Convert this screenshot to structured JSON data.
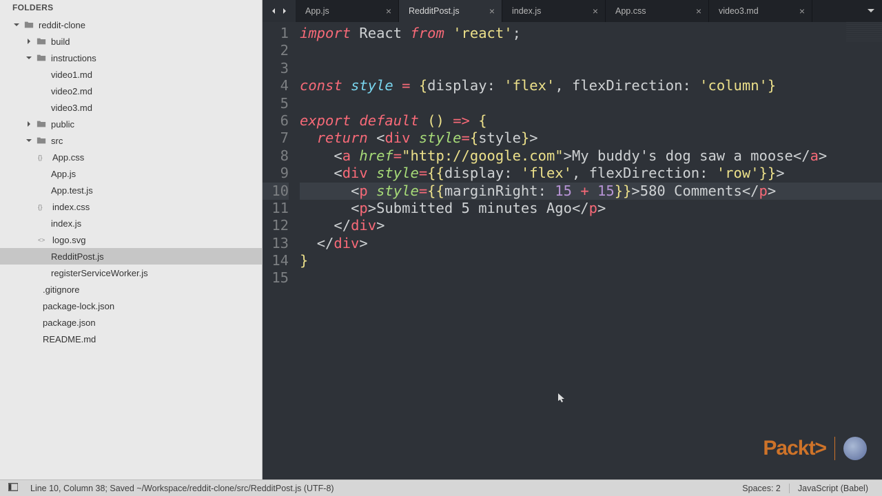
{
  "sidebar": {
    "header": "FOLDERS",
    "tree": {
      "root": "reddit-clone",
      "items": {
        "build": "build",
        "instructions": "instructions",
        "video1": "video1.md",
        "video2": "video2.md",
        "video3": "video3.md",
        "public": "public",
        "src": "src",
        "appcss": "App.css",
        "appjs": "App.js",
        "apptest": "App.test.js",
        "indexcss": "index.css",
        "indexjs": "index.js",
        "logosvg": "logo.svg",
        "redditpost": "RedditPost.js",
        "registersw": "registerServiceWorker.js",
        "gitignore": ".gitignore",
        "pkglock": "package-lock.json",
        "pkg": "package.json",
        "readme": "README.md"
      }
    }
  },
  "tabs": [
    {
      "label": "App.js",
      "active": false
    },
    {
      "label": "RedditPost.js",
      "active": true
    },
    {
      "label": "index.js",
      "active": false
    },
    {
      "label": "App.css",
      "active": false
    },
    {
      "label": "video3.md",
      "active": false
    }
  ],
  "editor": {
    "lines": 15,
    "highlight_line": 10,
    "code_tokens": [
      [
        [
          "kw",
          "import"
        ],
        [
          "pun",
          " "
        ],
        [
          "var",
          "React"
        ],
        [
          "pun",
          " "
        ],
        [
          "kw",
          "from"
        ],
        [
          "pun",
          " "
        ],
        [
          "str",
          "'react'"
        ],
        [
          "pun",
          ";"
        ]
      ],
      [],
      [],
      [
        [
          "kw",
          "const"
        ],
        [
          "pun",
          " "
        ],
        [
          "def",
          "style"
        ],
        [
          "pun",
          " "
        ],
        [
          "op",
          "="
        ],
        [
          "pun",
          " "
        ],
        [
          "paren",
          "{"
        ],
        [
          "var",
          "display"
        ],
        [
          "pun",
          ": "
        ],
        [
          "str",
          "'flex'"
        ],
        [
          "pun",
          ", "
        ],
        [
          "var",
          "flexDirection"
        ],
        [
          "pun",
          ": "
        ],
        [
          "str",
          "'column'"
        ],
        [
          "paren",
          "}"
        ]
      ],
      [],
      [
        [
          "kw",
          "export"
        ],
        [
          "pun",
          " "
        ],
        [
          "kw",
          "default"
        ],
        [
          "pun",
          " "
        ],
        [
          "paren",
          "()"
        ],
        [
          "pun",
          " "
        ],
        [
          "op",
          "=>"
        ],
        [
          "pun",
          " "
        ],
        [
          "paren",
          "{"
        ]
      ],
      [
        [
          "pun",
          "  "
        ],
        [
          "kw",
          "return"
        ],
        [
          "pun",
          " "
        ],
        [
          "pun",
          "<"
        ],
        [
          "tag",
          "div"
        ],
        [
          "pun",
          " "
        ],
        [
          "attr",
          "style"
        ],
        [
          "op",
          "="
        ],
        [
          "paren",
          "{"
        ],
        [
          "var",
          "style"
        ],
        [
          "paren",
          "}"
        ],
        [
          "pun",
          ">"
        ]
      ],
      [
        [
          "pun",
          "    "
        ],
        [
          "pun",
          "<"
        ],
        [
          "tag",
          "a"
        ],
        [
          "pun",
          " "
        ],
        [
          "attr",
          "href"
        ],
        [
          "op",
          "="
        ],
        [
          "str",
          "\"http://google.com\""
        ],
        [
          "pun",
          ">"
        ],
        [
          "txt",
          "My buddy's dog saw a moose"
        ],
        [
          "pun",
          "</"
        ],
        [
          "tag",
          "a"
        ],
        [
          "pun",
          ">"
        ]
      ],
      [
        [
          "pun",
          "    "
        ],
        [
          "pun",
          "<"
        ],
        [
          "tag",
          "div"
        ],
        [
          "pun",
          " "
        ],
        [
          "attr",
          "style"
        ],
        [
          "op",
          "="
        ],
        [
          "paren",
          "{{"
        ],
        [
          "var",
          "display"
        ],
        [
          "pun",
          ": "
        ],
        [
          "str",
          "'flex'"
        ],
        [
          "pun",
          ", "
        ],
        [
          "var",
          "flexDirection"
        ],
        [
          "pun",
          ": "
        ],
        [
          "str",
          "'row'"
        ],
        [
          "paren",
          "}}"
        ],
        [
          "pun",
          ">"
        ]
      ],
      [
        [
          "pun",
          "      "
        ],
        [
          "pun",
          "<"
        ],
        [
          "tag",
          "p"
        ],
        [
          "pun",
          " "
        ],
        [
          "attr",
          "style"
        ],
        [
          "op",
          "="
        ],
        [
          "paren",
          "{{"
        ],
        [
          "var",
          "marginRight"
        ],
        [
          "pun",
          ": "
        ],
        [
          "val",
          "15"
        ],
        [
          "pun",
          " "
        ],
        [
          "op",
          "+"
        ],
        [
          "pun",
          " "
        ],
        [
          "val",
          "15"
        ],
        [
          "paren",
          "}}"
        ],
        [
          "pun",
          ">"
        ],
        [
          "txt",
          "580 Comments"
        ],
        [
          "pun",
          "</"
        ],
        [
          "tag",
          "p"
        ],
        [
          "pun",
          ">"
        ]
      ],
      [
        [
          "pun",
          "      "
        ],
        [
          "pun",
          "<"
        ],
        [
          "tag",
          "p"
        ],
        [
          "pun",
          ">"
        ],
        [
          "txt",
          "Submitted 5 minutes Ago"
        ],
        [
          "pun",
          "</"
        ],
        [
          "tag",
          "p"
        ],
        [
          "pun",
          ">"
        ]
      ],
      [
        [
          "pun",
          "    "
        ],
        [
          "pun",
          "</"
        ],
        [
          "tag",
          "div"
        ],
        [
          "pun",
          ">"
        ]
      ],
      [
        [
          "pun",
          "  "
        ],
        [
          "pun",
          "</"
        ],
        [
          "tag",
          "div"
        ],
        [
          "pun",
          ">"
        ]
      ],
      [
        [
          "paren",
          "}"
        ]
      ],
      []
    ]
  },
  "statusbar": {
    "position": "Line 10, Column 38; Saved ~/Workspace/reddit-clone/src/RedditPost.js (UTF-8)",
    "spaces": "Spaces: 2",
    "syntax": "JavaScript (Babel)"
  },
  "watermark": {
    "brand": "Packt",
    "suffix": ">"
  }
}
